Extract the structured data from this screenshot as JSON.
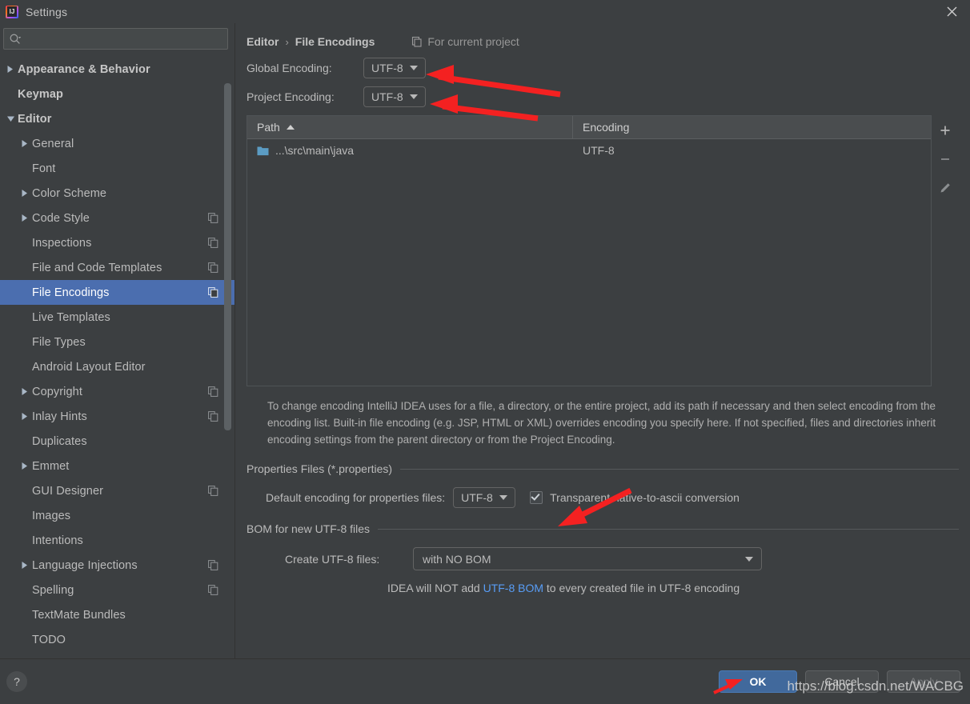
{
  "window": {
    "title": "Settings",
    "logo_icon": "intellij-idea-logo-icon",
    "close_icon": "close-icon"
  },
  "search": {
    "value": "",
    "placeholder": "",
    "icon": "search-icon"
  },
  "sidebar": {
    "items": [
      {
        "label": "Appearance & Behavior",
        "level": 0,
        "twisty": "collapsed",
        "bold": true,
        "badge": false,
        "selected": false
      },
      {
        "label": "Keymap",
        "level": 0,
        "twisty": "none",
        "bold": true,
        "badge": false,
        "selected": false
      },
      {
        "label": "Editor",
        "level": 0,
        "twisty": "expanded",
        "bold": true,
        "badge": false,
        "selected": false
      },
      {
        "label": "General",
        "level": 1,
        "twisty": "collapsed",
        "bold": false,
        "badge": false,
        "selected": false
      },
      {
        "label": "Font",
        "level": 1,
        "twisty": "none",
        "bold": false,
        "badge": false,
        "selected": false
      },
      {
        "label": "Color Scheme",
        "level": 1,
        "twisty": "collapsed",
        "bold": false,
        "badge": false,
        "selected": false
      },
      {
        "label": "Code Style",
        "level": 1,
        "twisty": "collapsed",
        "bold": false,
        "badge": true,
        "selected": false
      },
      {
        "label": "Inspections",
        "level": 1,
        "twisty": "none",
        "bold": false,
        "badge": true,
        "selected": false
      },
      {
        "label": "File and Code Templates",
        "level": 1,
        "twisty": "none",
        "bold": false,
        "badge": true,
        "selected": false
      },
      {
        "label": "File Encodings",
        "level": 1,
        "twisty": "none",
        "bold": false,
        "badge": true,
        "selected": true
      },
      {
        "label": "Live Templates",
        "level": 1,
        "twisty": "none",
        "bold": false,
        "badge": false,
        "selected": false
      },
      {
        "label": "File Types",
        "level": 1,
        "twisty": "none",
        "bold": false,
        "badge": false,
        "selected": false
      },
      {
        "label": "Android Layout Editor",
        "level": 1,
        "twisty": "none",
        "bold": false,
        "badge": false,
        "selected": false
      },
      {
        "label": "Copyright",
        "level": 1,
        "twisty": "collapsed",
        "bold": false,
        "badge": true,
        "selected": false
      },
      {
        "label": "Inlay Hints",
        "level": 1,
        "twisty": "collapsed",
        "bold": false,
        "badge": true,
        "selected": false
      },
      {
        "label": "Duplicates",
        "level": 1,
        "twisty": "none",
        "bold": false,
        "badge": false,
        "selected": false
      },
      {
        "label": "Emmet",
        "level": 1,
        "twisty": "collapsed",
        "bold": false,
        "badge": false,
        "selected": false
      },
      {
        "label": "GUI Designer",
        "level": 1,
        "twisty": "none",
        "bold": false,
        "badge": true,
        "selected": false
      },
      {
        "label": "Images",
        "level": 1,
        "twisty": "none",
        "bold": false,
        "badge": false,
        "selected": false
      },
      {
        "label": "Intentions",
        "level": 1,
        "twisty": "none",
        "bold": false,
        "badge": false,
        "selected": false
      },
      {
        "label": "Language Injections",
        "level": 1,
        "twisty": "collapsed",
        "bold": false,
        "badge": true,
        "selected": false
      },
      {
        "label": "Spelling",
        "level": 1,
        "twisty": "none",
        "bold": false,
        "badge": true,
        "selected": false
      },
      {
        "label": "TextMate Bundles",
        "level": 1,
        "twisty": "none",
        "bold": false,
        "badge": false,
        "selected": false
      },
      {
        "label": "TODO",
        "level": 1,
        "twisty": "none",
        "bold": false,
        "badge": false,
        "selected": false
      }
    ]
  },
  "main": {
    "breadcrumb": {
      "parent": "Editor",
      "separator": "›",
      "current": "File Encodings",
      "scope_label": "For current project",
      "scope_icon": "copy-scope-icon"
    },
    "global_encoding": {
      "label": "Global Encoding:",
      "value": "UTF-8"
    },
    "project_encoding": {
      "label": "Project Encoding:",
      "value": "UTF-8"
    },
    "table": {
      "columns": [
        "Path",
        "Encoding"
      ],
      "sort_column": "Path",
      "sort_direction": "ascending",
      "rows": [
        {
          "path": "...\\src\\main\\java",
          "encoding": "UTF-8",
          "icon": "folder-icon"
        }
      ],
      "tools": [
        {
          "name": "add-entry-button",
          "icon": "plus-icon"
        },
        {
          "name": "remove-entry-button",
          "icon": "minus-icon"
        },
        {
          "name": "edit-entry-button",
          "icon": "pencil-icon"
        }
      ]
    },
    "help_text": "To change encoding IntelliJ IDEA uses for a file, a directory, or the entire project, add its path if necessary and then select encoding from the encoding list. Built-in file encoding (e.g. JSP, HTML or XML) overrides encoding you specify here. If not specified, files and directories inherit encoding settings from the parent directory or from the Project Encoding.",
    "properties_group": {
      "title": "Properties Files (*.properties)",
      "default_encoding_label": "Default encoding for properties files:",
      "default_encoding_value": "UTF-8",
      "transparent_label": "Transparent native-to-ascii conversion",
      "transparent_checked": true
    },
    "bom_group": {
      "title": "BOM for new UTF-8 files",
      "create_label": "Create UTF-8 files:",
      "create_value": "with NO BOM",
      "note_prefix": "IDEA will NOT add ",
      "note_link": "UTF-8 BOM",
      "note_suffix": " to every created file in UTF-8 encoding"
    }
  },
  "footer": {
    "help_label": "?",
    "ok_label": "OK",
    "cancel_label": "Cancel",
    "apply_label": "Apply"
  },
  "watermark": "https://blog.csdn.net/WACBG",
  "colors": {
    "window_bg": "#3c3f41",
    "selection_blue": "#4b6eaf",
    "primary_button": "#41699c",
    "link_blue": "#589df6",
    "annotation_red": "#f42121",
    "folder_blue": "#5b9cc4"
  }
}
